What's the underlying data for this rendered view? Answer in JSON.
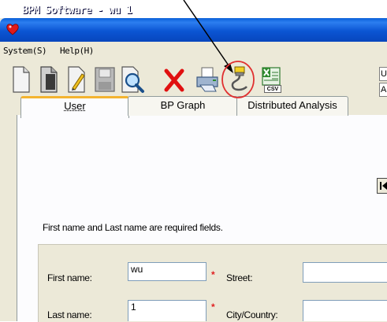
{
  "window": {
    "title": "BPM Software - wu 1"
  },
  "menu": [
    {
      "label": "System(S)"
    },
    {
      "label": "Help(H)"
    }
  ],
  "toolbar": {
    "buttons": [
      {
        "icon": "new-document-icon"
      },
      {
        "icon": "open-document-icon"
      },
      {
        "icon": "edit-document-icon"
      },
      {
        "icon": "save-disk-icon"
      },
      {
        "icon": "search-icon"
      },
      {
        "icon": "delete-x-icon"
      },
      {
        "icon": "print-icon"
      },
      {
        "icon": "serial-cable-icon"
      },
      {
        "icon": "csv-export-icon",
        "label": "CSV"
      }
    ],
    "right_stub_top": "U",
    "right_stub_bottom": "A"
  },
  "tabs": [
    {
      "label": "User",
      "active": true
    },
    {
      "label": "BP Graph",
      "active": false
    },
    {
      "label": "Distributed Analysis",
      "active": false
    }
  ],
  "user_form": {
    "required_note": "First name and Last name are required fields.",
    "first_name_label": "First name:",
    "first_name_value": "wu",
    "last_name_label": "Last name:",
    "last_name_value": "1",
    "street_label": "Street:",
    "street_value": "",
    "city_label": "City/Country:",
    "city_value": "",
    "required_marker": "*"
  },
  "colors": {
    "titlebar": "#0b55d3",
    "window_bg": "#ece9d8",
    "active_tab_accent": "#f3b42f",
    "required_marker": "#e02020",
    "annotation_circle": "#e03030"
  }
}
